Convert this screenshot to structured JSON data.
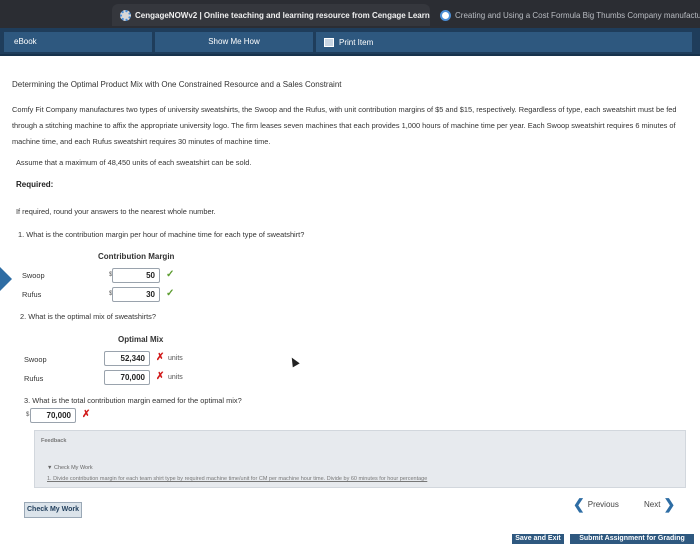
{
  "browser": {
    "active_tab": "CengageNOWv2 | Online teaching and learning resource from Cengage Learning",
    "inactive_tab": "Creating and Using a Cost Formula Big Thumbs Company manufactures po"
  },
  "toolbar": {
    "ebook": "eBook",
    "show_me_how": "Show Me How",
    "print_item": "Print Item"
  },
  "problem": {
    "title": "Determining the Optimal Product Mix with One Constrained Resource and a Sales Constraint",
    "paragraph": "Comfy Fit Company manufactures two types of university sweatshirts, the Swoop and the Rufus, with unit contribution margins of $5 and $15, respectively. Regardless of type, each sweatshirt must be fed through a stitching machine to affix the appropriate university logo. The firm leases seven machines that each provides 1,000 hours of machine time per year. Each Swoop sweatshirt requires 6 minutes of machine time, and each Rufus sweatshirt requires 30 minutes of machine time.",
    "assume": "Assume that a maximum of 48,450 units of each sweatshirt can be sold.",
    "required": "Required:",
    "rounding": "If required, round your answers to the nearest whole number."
  },
  "q1": {
    "text": "1.  What is the contribution margin per hour of machine time for each type of sweatshirt?",
    "column": "Contribution Margin",
    "rows": [
      {
        "label": "Swoop",
        "currency": "$",
        "value": "50",
        "status": "✓"
      },
      {
        "label": "Rufus",
        "currency": "$",
        "value": "30",
        "status": "✓"
      }
    ]
  },
  "q2": {
    "text": "2.  What is the optimal mix of sweatshirts?",
    "column": "Optimal Mix",
    "rows": [
      {
        "label": "Swoop",
        "value": "52,340",
        "status": "✗",
        "units": "units"
      },
      {
        "label": "Rufus",
        "value": "70,000",
        "status": "✗",
        "units": "units"
      }
    ]
  },
  "q3": {
    "text": "3.  What is the total contribution margin earned for the optimal mix?",
    "currency": "$",
    "value": "70,000",
    "status": "✗"
  },
  "feedback": {
    "label": "Feedback",
    "check_my_work": "▼ Check My Work",
    "hint": "1. Divide contribution margin for each team shirt type by required machine time/unit for CM per machine hour time. Divide by 60 minutes for hour percentage"
  },
  "footer": {
    "check_my_work": "Check My Work",
    "previous": "Previous",
    "next": "Next",
    "save_exit": "Save and Exit",
    "submit": "Submit Assignment for Grading"
  },
  "colors": {
    "toolbar": "#1f3d5b",
    "button": "#2e587f",
    "correct": "#5c9c2f",
    "incorrect": "#d11a1a"
  }
}
